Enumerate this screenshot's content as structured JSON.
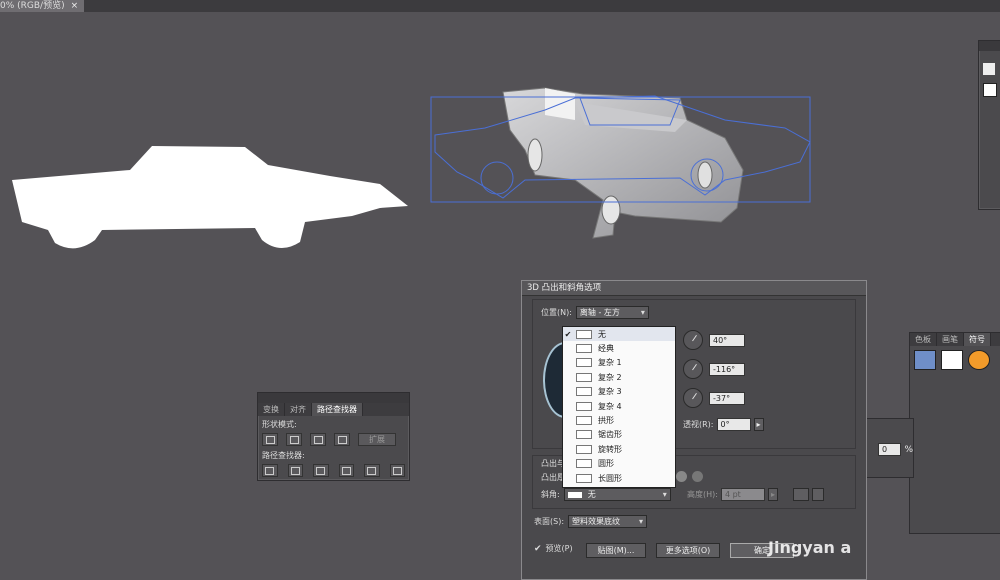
{
  "doc_tab": {
    "title": "0% (RGB/预览)",
    "close": "×"
  },
  "pathfinder": {
    "tabs": [
      "变换",
      "对齐",
      "路径查找器"
    ],
    "shape_modes_label": "形状模式:",
    "expand_label": "扩展",
    "pathfinders_label": "路径查找器:"
  },
  "dialog": {
    "title": "3D 凸出和斜角选项",
    "position_label": "位置(N):",
    "position_value": "离轴 - 左方",
    "angle_x": "40°",
    "angle_y": "-116°",
    "angle_z": "-37°",
    "perspective_label": "透视(R):",
    "perspective_value": "0°",
    "extrude_section": "凸出与",
    "extrude_depth_label": "凸出厚",
    "bevel_label": "斜角:",
    "bevel_value": "无",
    "height_label": "高度(H):",
    "height_value": "4 pt",
    "surface_label": "表面(S):",
    "surface_value": "塑料效果底纹",
    "preview_label": "预览(P)",
    "map_button": "贴图(M)...",
    "more_button": "更多选项(O)",
    "ok_button": "确定",
    "right_value": "0",
    "right_unit": "%"
  },
  "bevel_list": [
    {
      "label": "无",
      "selected": true
    },
    {
      "label": "经典",
      "selected": false
    },
    {
      "label": "复杂 1",
      "selected": false
    },
    {
      "label": "复杂 2",
      "selected": false
    },
    {
      "label": "复杂 3",
      "selected": false
    },
    {
      "label": "复杂 4",
      "selected": false
    },
    {
      "label": "拱形",
      "selected": false
    },
    {
      "label": "锯齿形",
      "selected": false
    },
    {
      "label": "旋转形",
      "selected": false
    },
    {
      "label": "圆形",
      "selected": false
    },
    {
      "label": "长圆形",
      "selected": false
    }
  ],
  "symbols_panel": {
    "tabs": [
      "色板",
      "画笔",
      "符号"
    ]
  },
  "watermark": "Jingyan  a",
  "colors": {
    "canvas": "#545256",
    "path_blue": "#4a6fd6",
    "car_white": "#ffffff"
  }
}
